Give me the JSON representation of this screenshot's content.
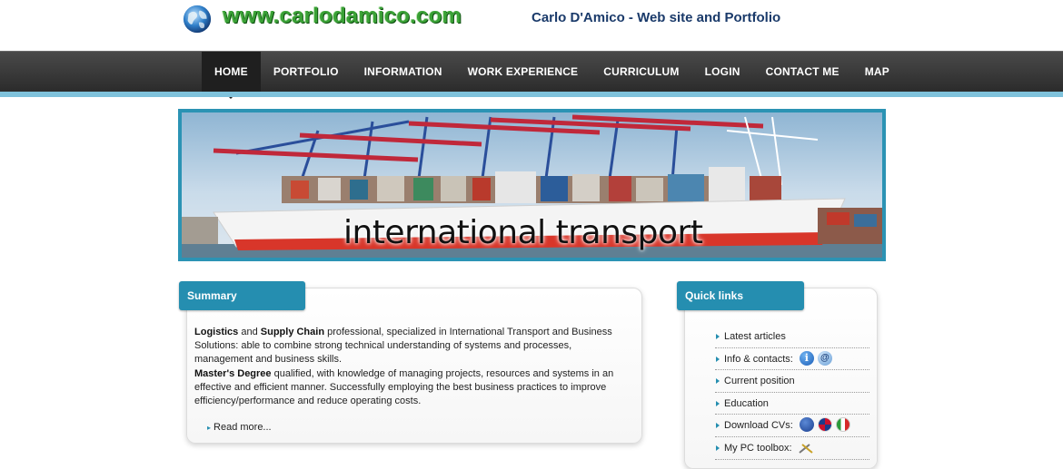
{
  "header": {
    "logo_text": "www.carlodamico.com",
    "site_title": "Carlo D'Amico - Web site and Portfolio"
  },
  "nav": {
    "items": [
      {
        "label": "HOME",
        "active": true
      },
      {
        "label": "PORTFOLIO"
      },
      {
        "label": "INFORMATION"
      },
      {
        "label": "WORK EXPERIENCE"
      },
      {
        "label": "CURRICULUM"
      },
      {
        "label": "LOGIN"
      },
      {
        "label": "CONTACT ME"
      },
      {
        "label": "MAP"
      }
    ]
  },
  "banner": {
    "caption": "international transport"
  },
  "summary": {
    "title": "Summary",
    "p1_bold1": "Logistics",
    "p1_and": " and ",
    "p1_bold2": "Supply Chain",
    "p1_rest": " professional, specialized in International Transport and Business Solutions: able to combine strong technical understanding of systems and processes, management and business skills.",
    "p2_bold": "Master's Degree",
    "p2_rest": " qualified, with knowledge of managing projects, resources and systems in an effective and efficient manner. Successfully employing the best business practices to improve efficiency/performance and reduce operating costs.",
    "read_more": "Read more..."
  },
  "quick_links": {
    "title": "Quick links",
    "items": [
      {
        "label": "Latest articles"
      },
      {
        "label": "Info & contacts:",
        "icons": [
          "info-icon",
          "email-at-icon"
        ]
      },
      {
        "label": "Current position"
      },
      {
        "label": "Education"
      },
      {
        "label": "Download CVs:",
        "icons": [
          "eu-flag-icon",
          "uk-flag-icon",
          "italy-flag-icon"
        ]
      },
      {
        "label": "My PC toolbox:",
        "icons": [
          "tools-icon"
        ]
      }
    ]
  },
  "colors": {
    "accent": "#258eb0",
    "nav_bg": "#2b2b2b",
    "nav_stripe": "#7fc2db",
    "logo_green": "#3aa136",
    "title_blue": "#1a3a6a"
  }
}
